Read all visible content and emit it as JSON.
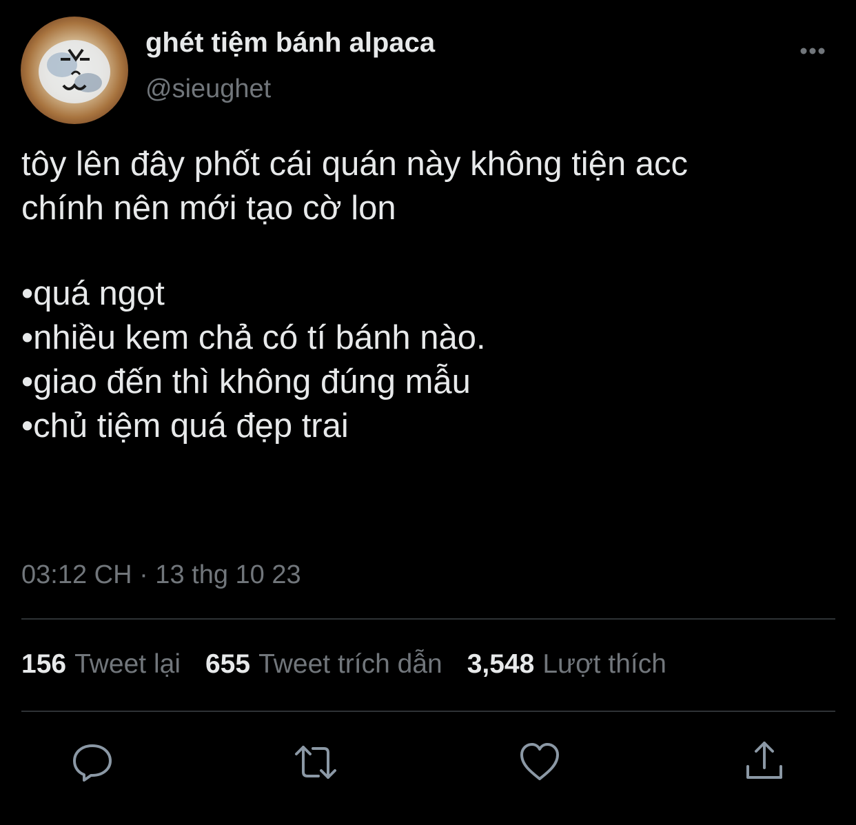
{
  "author": {
    "display_name": "ghét tiệm bánh alpaca",
    "handle": "@sieughet"
  },
  "tweet": {
    "lines": [
      "tôy lên đây phốt cái quán này không tiện acc",
      "chính nên mới tạo cờ lon",
      "•quá ngọt",
      "•nhiều kem chả có tí bánh nào.",
      "•giao đến thì không đúng mẫu",
      "•chủ tiệm quá đẹp trai"
    ],
    "timestamp": "03:12 CH · 13 thg 10 23"
  },
  "stats": {
    "retweets": {
      "count": "156",
      "label": "Tweet lại"
    },
    "quotes": {
      "count": "655",
      "label": "Tweet trích dẫn"
    },
    "likes": {
      "count": "3,548",
      "label": "Lượt thích"
    }
  },
  "actions": [
    "reply-icon",
    "retweet-icon",
    "like-icon",
    "share-icon"
  ],
  "colors": {
    "background": "#000000",
    "text_primary": "#e7e9ea",
    "text_secondary": "#71767b",
    "divider": "#2f3336"
  }
}
